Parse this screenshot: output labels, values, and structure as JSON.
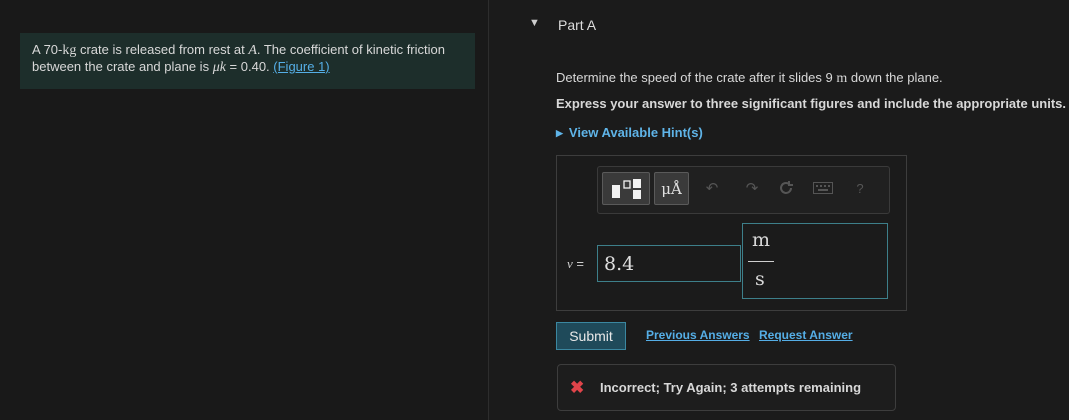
{
  "problem": {
    "text_1": "A 70-",
    "unit_kg": "kg",
    "text_2": " crate is released from rest at ",
    "point": "A",
    "text_3": ". The coefficient of kinetic friction between the crate and plane is ",
    "mu_k": "μk",
    "text_4": " = 0.40. ",
    "figure_link": "(Figure 1)"
  },
  "part": {
    "toggle_icon": "triangle-down-icon",
    "title": "Part A"
  },
  "question": {
    "text_1": "Determine the speed of the crate after it slides 9 ",
    "unit": "m",
    "text_2": " down the plane."
  },
  "instruction": "Express your answer to three significant figures and include the appropriate units.",
  "hint": {
    "icon": "triangle-right-icon",
    "label": "View Available Hint(s)"
  },
  "toolbar": {
    "template_icon": "template-icon",
    "units_label": "μÅ",
    "undo_icon": "undo-icon",
    "redo_icon": "redo-icon",
    "reset_icon": "reset-icon",
    "keyboard_icon": "keyboard-icon",
    "help_label": "?"
  },
  "answer": {
    "variable": "v",
    "equals": " =",
    "value": "8.4",
    "unit_numerator": "m",
    "unit_denominator": "s"
  },
  "actions": {
    "submit": "Submit",
    "previous_answers": "Previous Answers",
    "request_answer": "Request Answer"
  },
  "feedback": {
    "icon": "x-icon",
    "text": "Incorrect; Try Again; 3 attempts remaining"
  },
  "colors": {
    "accent_link": "#55aee6",
    "error": "#e0444a",
    "input_border": "#3d7f8a"
  }
}
